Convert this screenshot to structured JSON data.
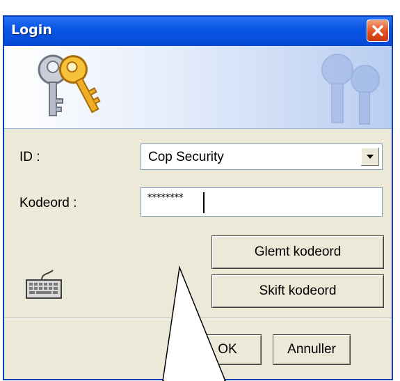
{
  "window": {
    "title": "Login",
    "close_icon": "close-icon"
  },
  "banner": {
    "keys_icon": "keys-icon",
    "watermark_icon": "keys-watermark-icon"
  },
  "form": {
    "id_label": "ID :",
    "id_value": "Cop Security",
    "password_label": "Kodeord :",
    "password_value": "********"
  },
  "buttons": {
    "forgot_password": "Glemt kodeord",
    "change_password": "Skift kodeord",
    "ok": "OK",
    "cancel": "Annuller"
  },
  "icons": {
    "keyboard": "keyboard-icon",
    "dropdown": "chevron-down-icon"
  },
  "colors": {
    "titlebar": "#0649d6",
    "close_button": "#e3511f",
    "dialog_background": "#ece9d8"
  }
}
